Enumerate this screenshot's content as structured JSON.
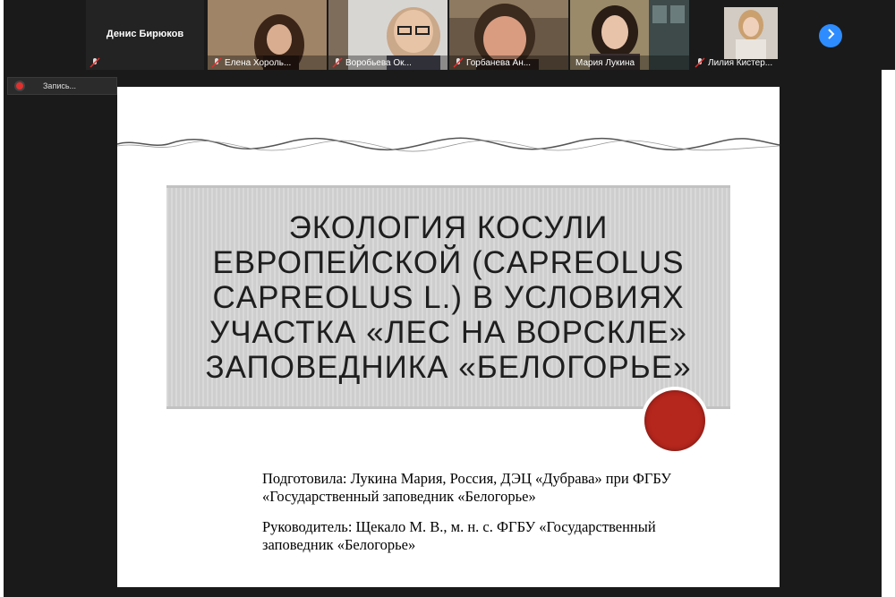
{
  "gallery": {
    "participants": [
      {
        "name": "Денис Бирюков",
        "muted": true
      },
      {
        "name": "Елена Хороль...",
        "muted": true
      },
      {
        "name": "Воробьева Ок...",
        "muted": true
      },
      {
        "name": "Горбанева Ан...",
        "muted": true
      },
      {
        "name": "Мария Лукина",
        "muted": false
      },
      {
        "name": "Лилия Кистер...",
        "muted": true
      }
    ],
    "next_icon": "chevron-right-icon"
  },
  "recording": {
    "label": "Запись...",
    "color": "#e0312f"
  },
  "slide": {
    "title": "Экология косули европейской (Capreolus capreolus L.) в условиях участка «Лес на Ворскле» заповедника «Белогорье»",
    "prepared_by": "Подготовила: Лукина Мария, Россия, ДЭЦ «Дубрава» при ФГБУ «Государственный заповедник «Белогорье»",
    "supervisor": "Руководитель: Щекало М. В., м. н. с. ФГБУ «Государственный заповедник «Белогорье»",
    "accent_color": "#b5261d"
  }
}
